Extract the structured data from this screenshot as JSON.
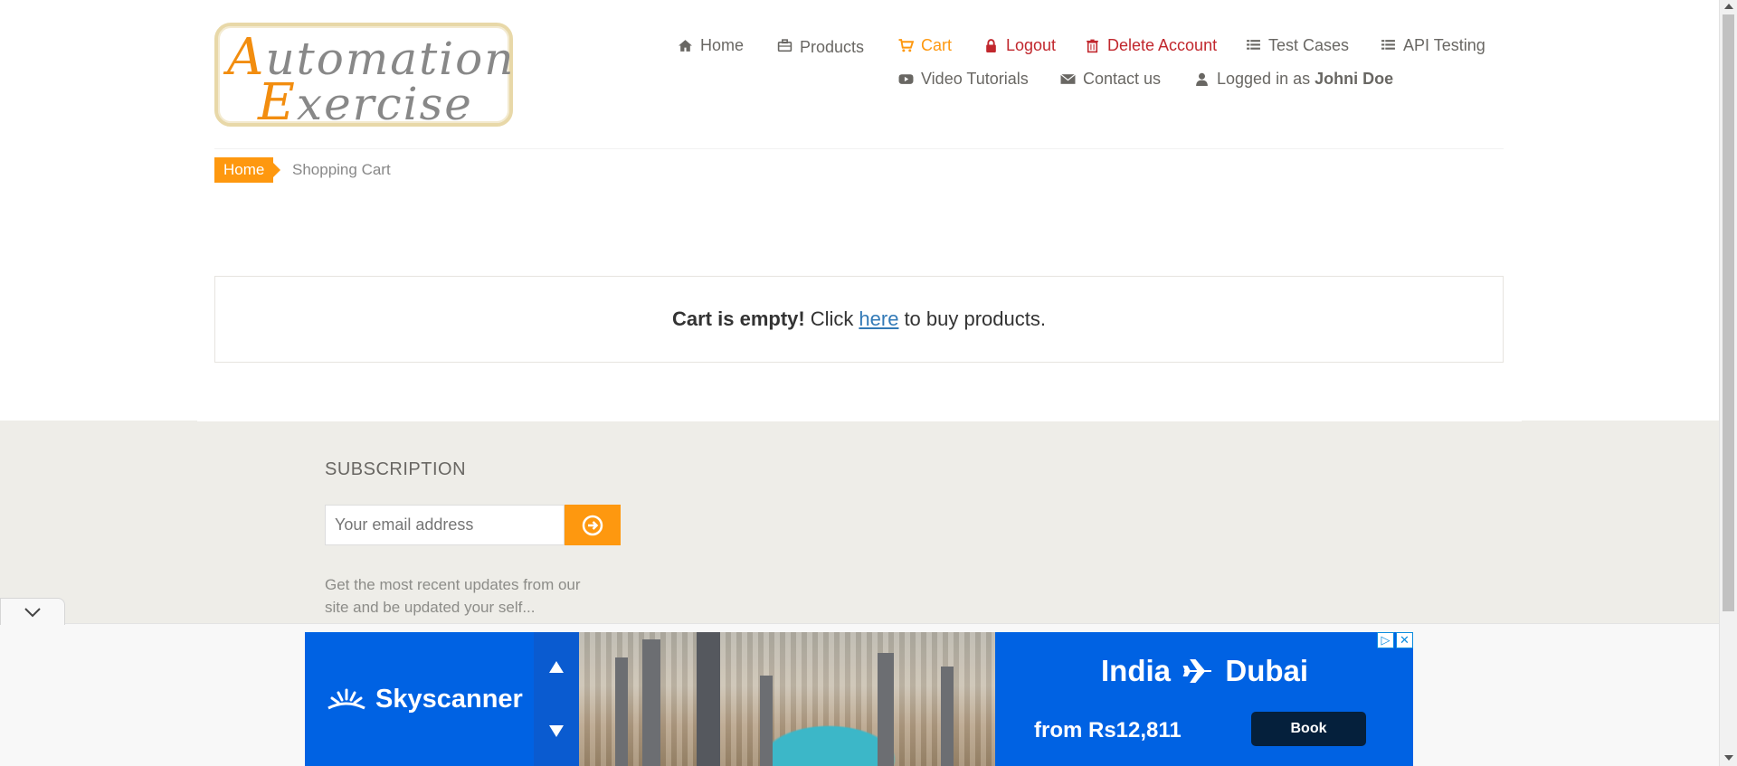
{
  "logo": {
    "line1_cap": "A",
    "line1_rest": "utomation",
    "line2_cap": "E",
    "line2_rest": "xercise"
  },
  "nav": {
    "home": "Home",
    "products": "Products",
    "cart": "Cart",
    "logout": "Logout",
    "delete_account": "Delete Account",
    "test_cases": "Test Cases",
    "api_testing": "API Testing",
    "video_tutorials": "Video Tutorials",
    "contact_us": "Contact us",
    "logged_in_prefix": "Logged in as",
    "username": "Johni Doe"
  },
  "breadcrumb": {
    "home": "Home",
    "current": "Shopping Cart"
  },
  "cart": {
    "empty_bold": "Cart is empty!",
    "click": "Click",
    "link": "here",
    "suffix": "to buy products."
  },
  "subscription": {
    "title": "SUBSCRIPTION",
    "placeholder": "Your email address",
    "description": "Get the most recent updates from our site and be updated your self..."
  },
  "ad": {
    "brand": "Skyscanner",
    "headline_from": "India",
    "headline_to": "Dubai",
    "price": "from Rs12,811",
    "cta": "Book"
  },
  "colors": {
    "accent": "#fe980f",
    "danger": "#c1272d",
    "link": "#337ab7",
    "ad_blue": "#0062e3"
  }
}
